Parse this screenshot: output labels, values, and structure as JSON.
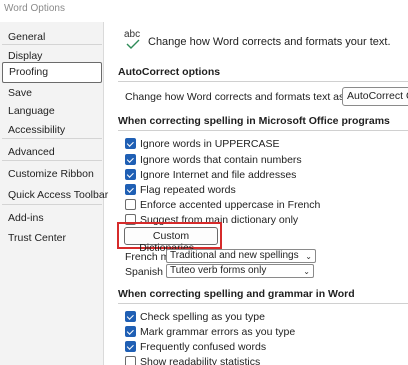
{
  "window": {
    "title": "Word Options"
  },
  "sidebar": {
    "items": [
      {
        "label": "General"
      },
      {
        "label": "Display"
      },
      {
        "label": "Proofing"
      },
      {
        "label": "Save"
      },
      {
        "label": "Language"
      },
      {
        "label": "Accessibility"
      },
      {
        "label": "Advanced"
      },
      {
        "label": "Customize Ribbon"
      },
      {
        "label": "Quick Access Toolbar"
      },
      {
        "label": "Add-ins"
      },
      {
        "label": "Trust Center"
      }
    ],
    "active": "Proofing"
  },
  "header": {
    "icon_text": "abc",
    "text": "Change how Word corrects and formats your text."
  },
  "autocorrect": {
    "heading": "AutoCorrect options",
    "label": "Change how Word corrects and formats text as you type:",
    "button": "AutoCorrect Options..."
  },
  "spelling_office": {
    "heading": "When correcting spelling in Microsoft Office programs",
    "options": [
      {
        "label": "Ignore words in UPPERCASE",
        "checked": true
      },
      {
        "label": "Ignore words that contain numbers",
        "checked": true
      },
      {
        "label": "Ignore Internet and file addresses",
        "checked": true
      },
      {
        "label": "Flag repeated words",
        "checked": true
      },
      {
        "label": "Enforce accented uppercase in French",
        "checked": false
      },
      {
        "label": "Suggest from main dictionary only",
        "checked": false
      }
    ],
    "custom_dict_button": "Custom Dictionaries...",
    "highlight_color": "#d62b2b",
    "french_label": "French modes:",
    "french_value": "Traditional and new spellings",
    "spanish_label": "Spanish modes:",
    "spanish_value": "Tuteo verb forms only"
  },
  "spelling_word": {
    "heading": "When correcting spelling and grammar in Word",
    "options": [
      {
        "label": "Check spelling as you type",
        "checked": true
      },
      {
        "label": "Mark grammar errors as you type",
        "checked": true
      },
      {
        "label": "Frequently confused words",
        "checked": true
      },
      {
        "label": "Show readability statistics",
        "checked": false
      }
    ]
  },
  "colors": {
    "accent": "#1f5fb4",
    "sidebar_bg": "#f3f3f3"
  }
}
